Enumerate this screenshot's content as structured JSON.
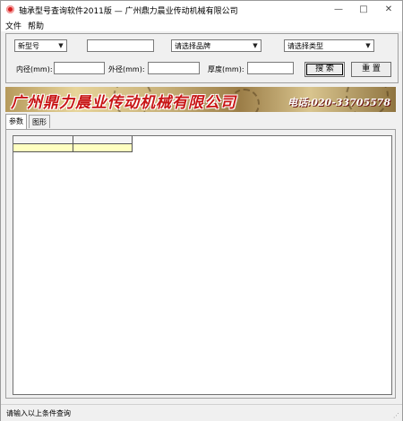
{
  "window": {
    "title": "轴承型号查询软件2011版 — 广州鼎力晨业传动机械有限公司",
    "minimize_glyph": "—",
    "maximize_glyph": "□",
    "close_glyph": "✕"
  },
  "menu": {
    "items": [
      "文件",
      "帮助"
    ]
  },
  "search": {
    "model_combo": "新型号",
    "model_input": "",
    "brand_combo": "请选择品牌",
    "type_combo": "请选择类型",
    "inner_label": "内径(mm):",
    "outer_label": "外径(mm):",
    "thickness_label": "厚度(mm):",
    "inner_value": "",
    "outer_value": "",
    "thickness_value": "",
    "search_button": "搜 索",
    "reset_button": "重 置"
  },
  "banner": {
    "company": "广州鼎力晨业传动机械有限公司",
    "phone": "电话:020-33705578"
  },
  "tabs": [
    "参数",
    "图形"
  ],
  "status": {
    "message": "请输入以上条件查询"
  },
  "icons": {
    "app": "app-logo-icon",
    "dropdown": "chevron-down-icon",
    "grip": "resize-grip-icon"
  }
}
